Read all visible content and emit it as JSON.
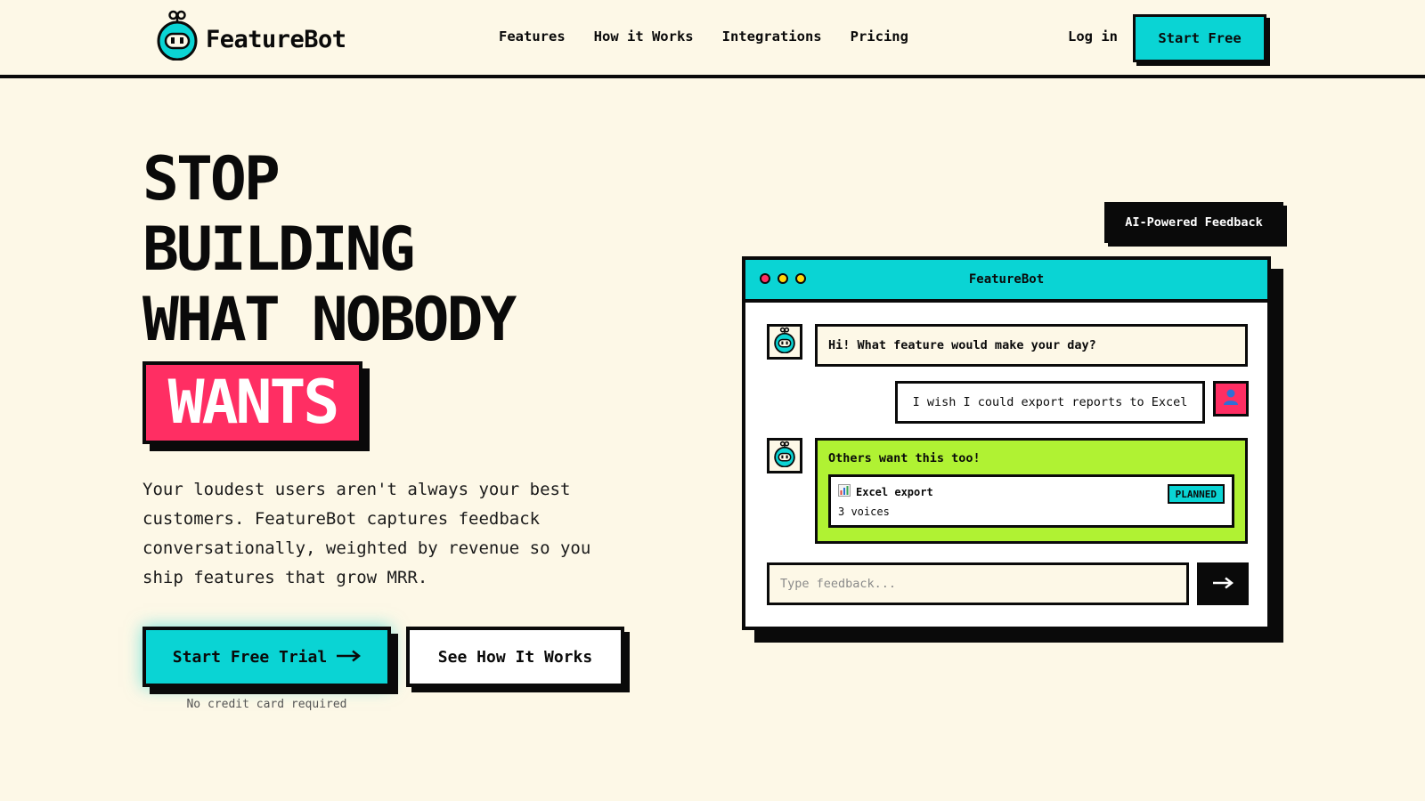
{
  "brand": {
    "name": "FeatureBot",
    "accent": "#0ad4d4",
    "pink": "#ff2e63",
    "lime": "#b0f233",
    "background": "#fdf8e7",
    "logo_icon": "robot-icon"
  },
  "nav": {
    "links": [
      {
        "label": "Features"
      },
      {
        "label": "How it Works"
      },
      {
        "label": "Integrations"
      },
      {
        "label": "Pricing"
      }
    ],
    "login": "Log in",
    "cta": "Start Free"
  },
  "hero": {
    "headline_lines": [
      "STOP",
      "BUILDING",
      "WHAT NOBODY"
    ],
    "highlight": "WANTS",
    "subhead": "Your loudest users aren't always your best customers. FeatureBot captures feedback conversationally, weighted by revenue so you ship features that grow MRR.",
    "primary_cta": "Start Free Trial",
    "primary_cta_icon": "arrow-right-icon",
    "secondary_cta": "See How It Works",
    "note": "No credit card required"
  },
  "chat": {
    "badge": "AI-Powered Feedback",
    "window_title": "FeatureBot",
    "bot_message": "Hi! What feature would make your day?",
    "user_message": "I wish I could export reports to Excel",
    "user_avatar_icon": "user-icon",
    "bot_avatar_icon": "robot-icon",
    "reply_title": "Others want this too!",
    "feature": {
      "icon": "bar-chart-icon",
      "name": "Excel export",
      "votes": "3 voices",
      "status": "PLANNED"
    },
    "input_placeholder": "Type feedback...",
    "send_icon": "arrow-right-icon"
  }
}
